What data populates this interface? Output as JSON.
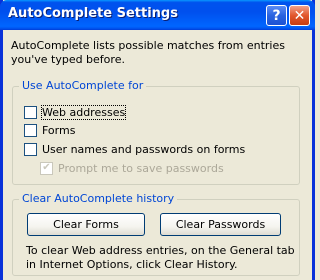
{
  "window": {
    "title": "AutoComplete Settings",
    "help_glyph": "?",
    "close_glyph": "✕"
  },
  "intro_text": "AutoComplete lists possible matches from entries you've typed before.",
  "use_group": {
    "legend": "Use AutoComplete for",
    "options": [
      {
        "label": "Web addresses",
        "checked": false,
        "enabled": true
      },
      {
        "label": "Forms",
        "checked": false,
        "enabled": true
      },
      {
        "label": "User names and passwords on forms",
        "checked": false,
        "enabled": true
      },
      {
        "label": "Prompt me to save passwords",
        "checked": true,
        "enabled": false
      }
    ]
  },
  "history_group": {
    "legend": "Clear AutoComplete history",
    "clear_forms_label": "Clear Forms",
    "clear_passwords_label": "Clear Passwords",
    "note": "To clear Web address entries, on the General tab in Internet Options, click Clear History."
  },
  "colors": {
    "title_bar": "#0054e3",
    "group_legend": "#0046d5",
    "dialog_bg": "#ece9d8"
  }
}
